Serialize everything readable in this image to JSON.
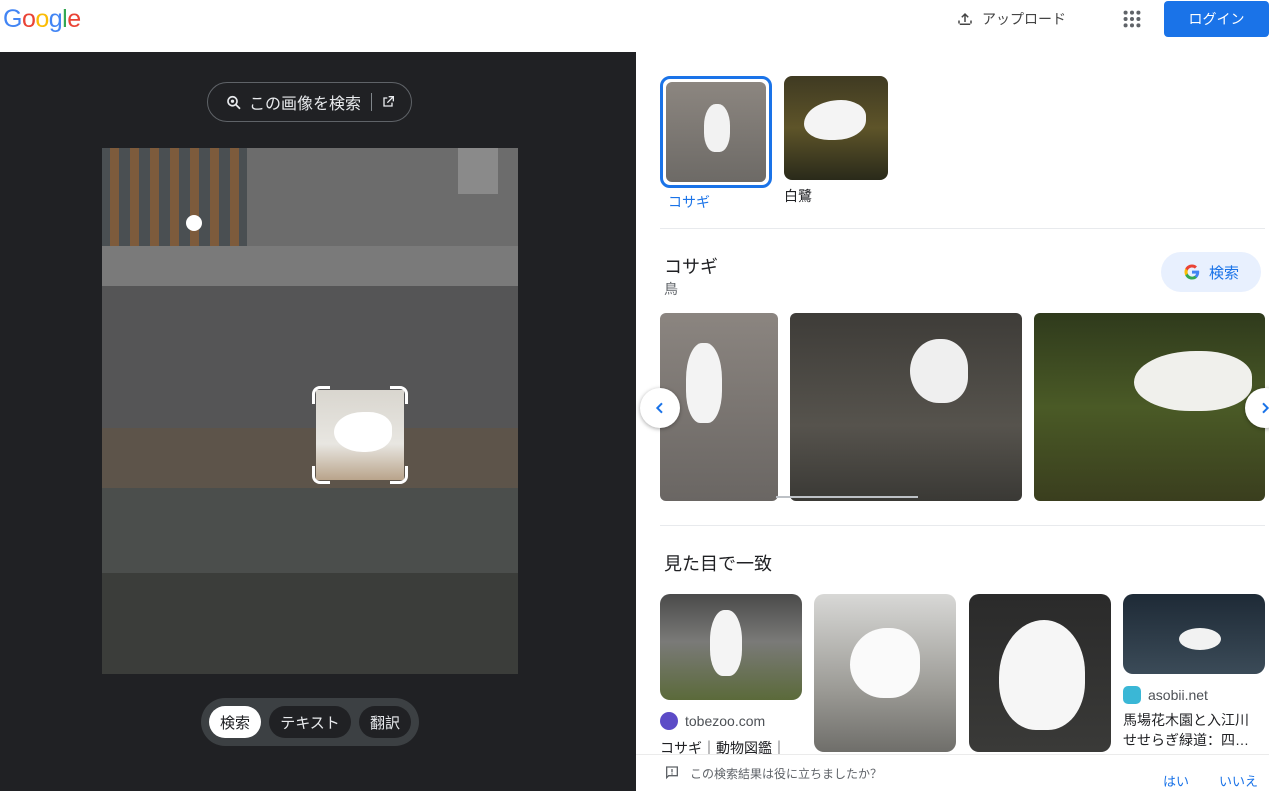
{
  "header": {
    "logo_letters": [
      "G",
      "o",
      "o",
      "g",
      "l",
      "e"
    ],
    "logo_colors": [
      "#4285f4",
      "#ea4335",
      "#fbbc05",
      "#4285f4",
      "#34a853",
      "#ea4335"
    ],
    "upload_label": "アップロード",
    "login_label": "ログイン"
  },
  "left": {
    "search_image_label": "この画像を検索",
    "modes": [
      {
        "label": "検索",
        "active": true
      },
      {
        "label": "テキスト",
        "active": false
      },
      {
        "label": "翻訳",
        "active": false
      }
    ]
  },
  "related": [
    {
      "name": "コサギ",
      "selected": true
    },
    {
      "name": "白鷺",
      "selected": false
    }
  ],
  "entity": {
    "title": "コサギ",
    "subtitle": "鳥",
    "search_label": "検索"
  },
  "visual_matches": {
    "title": "見た目で一致",
    "cards": [
      {
        "source": "tobezoo.com",
        "caption": "コサギ｜動物図鑑｜",
        "favicon_color": "#5c4bc7"
      },
      {
        "source": "",
        "caption": "",
        "favicon_color": ""
      },
      {
        "source": "",
        "caption": "",
        "favicon_color": ""
      },
      {
        "source": "asobii.net",
        "caption_line1": "馬場花木園と入江川",
        "caption_line2": "せせらぎ緑道：四…",
        "favicon_color": "#3ab7d6"
      }
    ]
  },
  "feedback": {
    "question": "この検索結果は役に立ちましたか？",
    "yes": "はい",
    "no": "いいえ"
  },
  "colors": {
    "accent": "#1a73e8",
    "dark_bg": "#202124"
  }
}
